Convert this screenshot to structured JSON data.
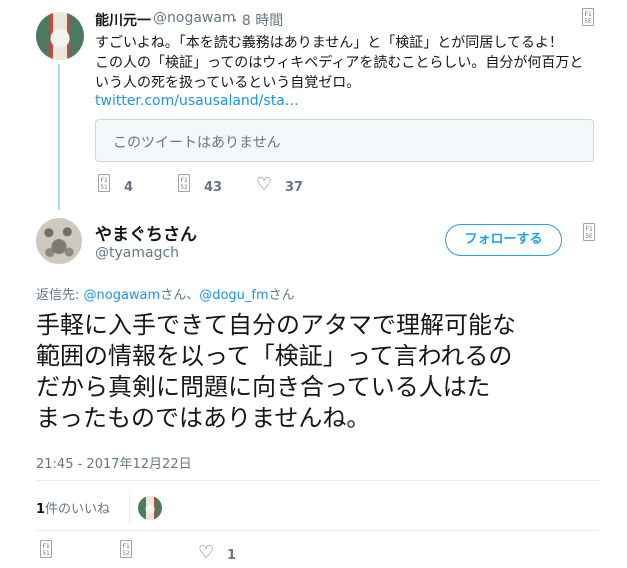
{
  "parent_tweet": {
    "display_name": "能川元一",
    "handle": "@nogawam",
    "time": "· 8 時間",
    "lines": [
      "すごいよね。「本を読む義務はありません」と「検証」とが同居してるよ！",
      "この人の「検証」ってのはウィキペディアを読むことらしい。自分が何百万と",
      "いう人の死を扱っているという自覚ゼロ。"
    ],
    "link": "twitter.com/usausaland/sta…",
    "quote_unavailable": "このツイートはありません",
    "reply_count": "4",
    "retweet_count": "43",
    "like_count": "37"
  },
  "main_tweet": {
    "display_name": "やまぐちさん",
    "handle": "@tyamagch",
    "follow_label": "フォローする",
    "reply_prefix": "返信先: ",
    "mention1": "@nogawam",
    "mention_join": "さん、",
    "mention2": "@dogu_fm",
    "mention_suffix": "さん",
    "lines": [
      "手軽に入手できて自分のアタマで理解可能な",
      "範囲の情報を以って「検証」って言われるの",
      "だから真剣に問題に向き合っている人はた",
      "まったものではありませんね。"
    ],
    "timestamp": "21:45 - 2017年12月22日",
    "likes_count": "1",
    "likes_label": "件のいいね",
    "like_count": "1"
  },
  "icons": {
    "reply": "reply-icon",
    "retweet": "retweet-icon",
    "like": "heart-icon",
    "more": "more-menu-icon"
  },
  "colors": {
    "link": "#1b95e0",
    "accent": "#1da1f2",
    "thread_line": "#a8dff0",
    "muted": "#657786"
  }
}
